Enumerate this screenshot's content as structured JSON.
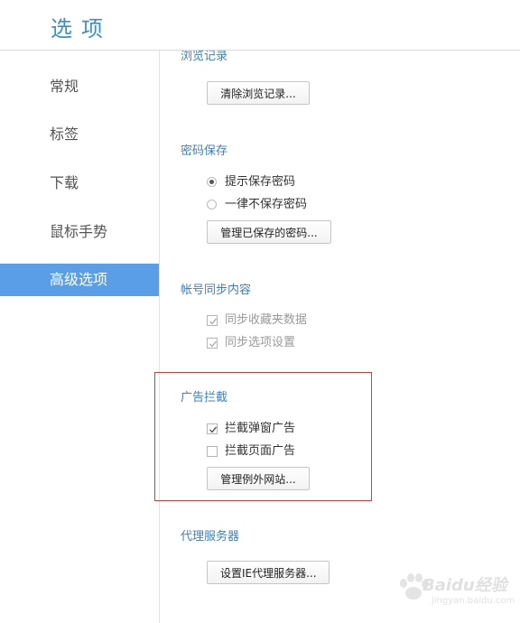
{
  "header": {
    "title": "选项"
  },
  "sidebar": {
    "items": [
      {
        "label": "常规"
      },
      {
        "label": "标签"
      },
      {
        "label": "下载"
      },
      {
        "label": "鼠标手势"
      },
      {
        "label": "高级选项"
      }
    ],
    "active_index": 4
  },
  "content": {
    "history": {
      "title": "浏览记录",
      "clear_button": "清除浏览记录..."
    },
    "password": {
      "title": "密码保存",
      "options": [
        {
          "label": "提示保存密码",
          "selected": true
        },
        {
          "label": "一律不保存密码",
          "selected": false
        }
      ],
      "manage_button": "管理已保存的密码..."
    },
    "sync": {
      "title": "帐号同步内容",
      "options": [
        {
          "label": "同步收藏夹数据",
          "checked": true,
          "disabled": true
        },
        {
          "label": "同步选项设置",
          "checked": true,
          "disabled": true
        }
      ]
    },
    "adblock": {
      "title": "广告拦截",
      "options": [
        {
          "label": "拦截弹窗广告",
          "checked": true
        },
        {
          "label": "拦截页面广告",
          "checked": false
        }
      ],
      "manage_button": "管理例外网站..."
    },
    "proxy": {
      "title": "代理服务器",
      "button": "设置IE代理服务器..."
    }
  },
  "watermark": {
    "text": "Baidu经验",
    "sub": "jingyan.baidu.com"
  },
  "colors": {
    "accent": "#3b8fd6",
    "active_nav": "#5a9ee7",
    "section_title": "#3f7fbf",
    "highlight": "#d63c3c"
  }
}
